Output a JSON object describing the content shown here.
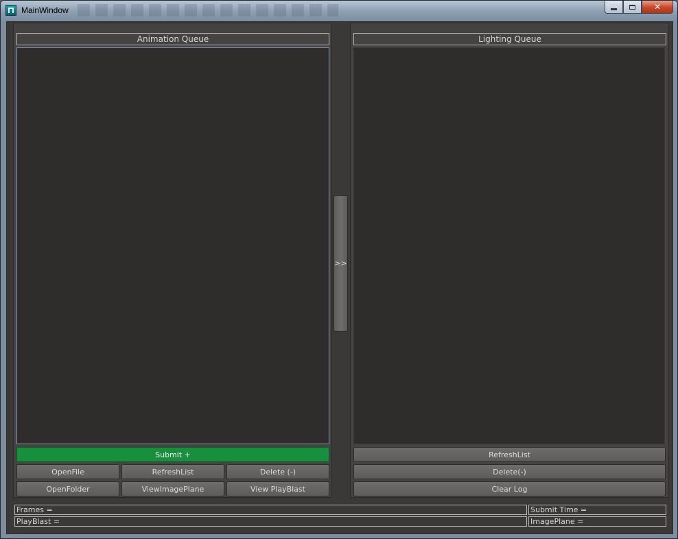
{
  "window": {
    "title": "MainWindow",
    "controls": {
      "minimize": "0",
      "maximize": "1",
      "close": "r"
    }
  },
  "left_panel": {
    "header": "Animation Queue",
    "submit_label": "Submit +",
    "row1": [
      "OpenFile",
      "RefreshList",
      "Delete (-)"
    ],
    "row2": [
      "OpenFolder",
      "ViewImagePlane",
      "View PlayBlast"
    ]
  },
  "transfer_button": {
    "label": ">>"
  },
  "right_panel": {
    "header": "Lighting Queue",
    "buttons": [
      "RefreshList",
      "Delete(-)",
      "Clear Log"
    ]
  },
  "status": {
    "frames": "Frames =",
    "submit_time": "Submit Time =",
    "playblast": "PlayBlast =",
    "imageplane": "ImagePlane ="
  },
  "colors": {
    "submit_green": "#178f3c",
    "list_background": "#2e2d2b",
    "selected_list_border": "#7d95b3"
  },
  "icons": {
    "app": "maya-app-icon",
    "minimize": "minimize-icon",
    "maximize": "maximize-icon",
    "close": "close-icon"
  }
}
